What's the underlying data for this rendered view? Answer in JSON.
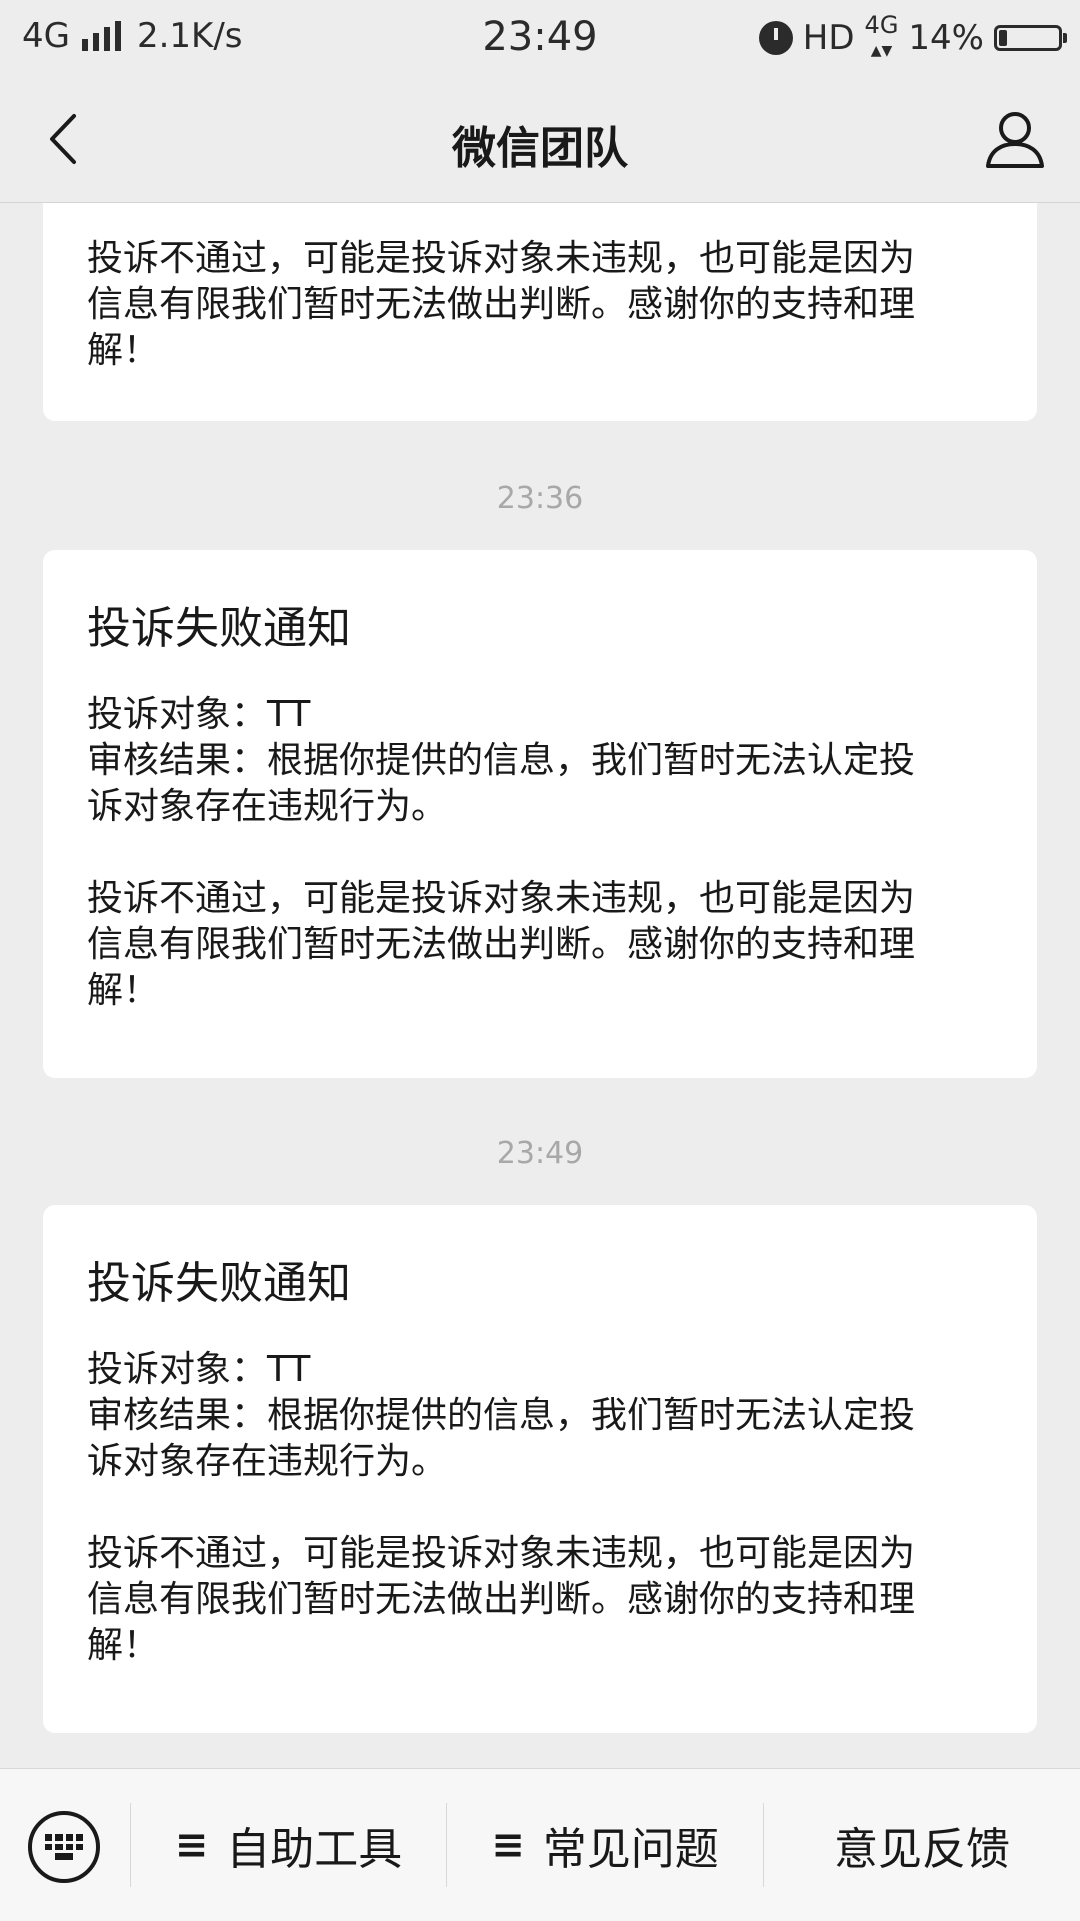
{
  "status_bar": {
    "network": "4G",
    "speed": "2.1K/s",
    "time": "23:49",
    "hd": "HD",
    "network_right": "4G",
    "battery_percent": "14%",
    "battery_level": 0.14
  },
  "nav": {
    "title": "微信团队",
    "back_icon": "chevron-left-icon",
    "profile_icon": "person-icon"
  },
  "messages": [
    {
      "partial": true,
      "body2_lines": [
        "投诉不通过，可能是投诉对象未违规，也可能是因为",
        "信息有限我们暂时无法做出判断。感谢你的支持和理",
        "解！"
      ]
    },
    {
      "time": "23:36",
      "title": "投诉失败通知",
      "target_line": "投诉对象：TT",
      "result_lines": [
        "审核结果：根据你提供的信息，我们暂时无法认定投",
        "诉对象存在违规行为。"
      ],
      "body2_lines": [
        "投诉不通过，可能是投诉对象未违规，也可能是因为",
        "信息有限我们暂时无法做出判断。感谢你的支持和理",
        "解！"
      ]
    },
    {
      "time": "23:49",
      "title": "投诉失败通知",
      "target_line": "投诉对象：TT",
      "result_lines": [
        "审核结果：根据你提供的信息，我们暂时无法认定投",
        "诉对象存在违规行为。"
      ],
      "body2_lines": [
        "投诉不通过，可能是投诉对象未违规，也可能是因为",
        "信息有限我们暂时无法做出判断。感谢你的支持和理",
        "解！"
      ]
    }
  ],
  "menu": {
    "keyboard_icon": "keyboard-icon",
    "items": [
      {
        "icon": "≡",
        "label": "自助工具"
      },
      {
        "icon": "≡",
        "label": "常见问题"
      },
      {
        "icon": "",
        "label": "意见反馈"
      }
    ]
  },
  "colors": {
    "background": "#ededed",
    "card": "#ffffff",
    "timestamp": "#a8a8a8",
    "text": "#191919"
  }
}
